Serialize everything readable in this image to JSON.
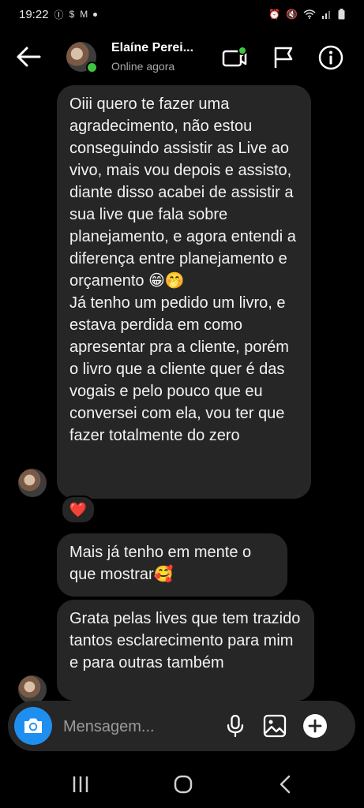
{
  "status_bar": {
    "time": "19:22",
    "left_icons": [
      "bluetooth-sync-icon",
      "dollar-app-icon",
      "gmail-icon"
    ],
    "right_icons": [
      "alarm-icon",
      "mute-icon",
      "wifi-icon",
      "signal-icon",
      "battery-icon"
    ]
  },
  "header": {
    "contact_name": "Elaíne Perei...",
    "contact_status": "Online agora"
  },
  "messages": [
    {
      "text": "Oiii quero te fazer uma agradecimento, não estou conseguindo assistir as Live ao vivo, mais vou depois e assisto, diante disso acabei de assistir a sua live que fala sobre planejamento, e agora entendi a diferença entre planejamento e orçamento 😁🤭\nJá tenho um pedido um livro, e estava perdida em como apresentar pra a cliente, porém o livro que a cliente quer é das vogais e pelo pouco que eu conversei com ela, vou ter que fazer totalmente do zero",
      "reaction": "❤️"
    },
    {
      "text": "Mais já tenho em mente o que mostrar🥰"
    },
    {
      "text": "Grata pelas lives que tem trazido tantos esclarecimento para mim e para outras também"
    }
  ],
  "composer": {
    "placeholder": "Mensagem..."
  },
  "colors": {
    "background": "#000000",
    "bubble": "#262626",
    "accent_blue": "#1f8fef",
    "online_green": "#3fc43f"
  }
}
